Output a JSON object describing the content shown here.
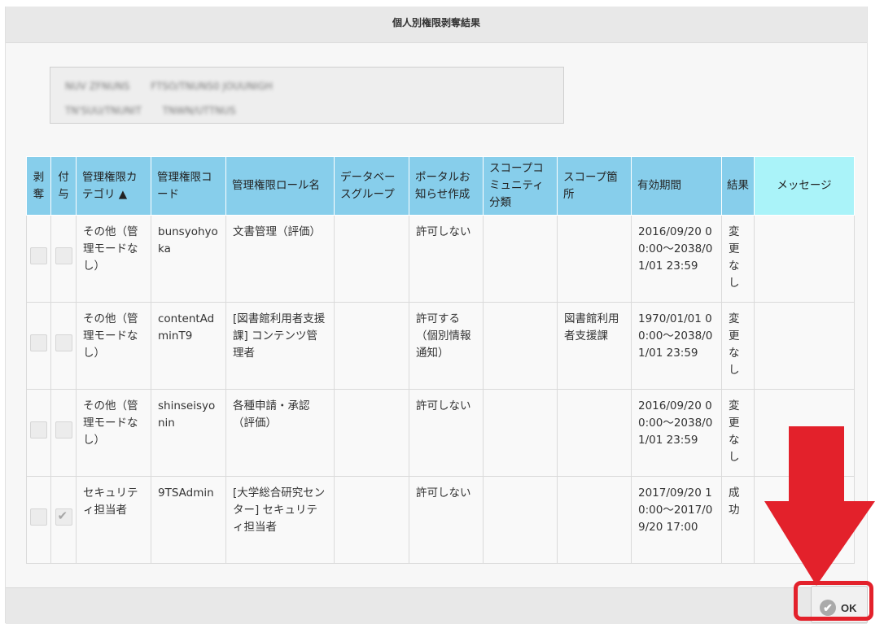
{
  "dialog": {
    "title": "個人別権限剥奪結果",
    "info_lines": [
      [
        "NUV ZFNUNS",
        "FTSO/TNUNS0 JOUUNIGH"
      ],
      [
        "TN'SUU/TNUNIT",
        "TNWN/UTTNUS"
      ]
    ]
  },
  "table": {
    "headers": {
      "revoke": "剥奪",
      "grant": "付与",
      "category": "管理権限カテゴリ ▲",
      "code": "管理権限コード",
      "role": "管理権限ロール名",
      "dbgroup": "データベースグループ",
      "portal": "ポータルお知らせ作成",
      "scope_comm": "スコープコミュニティ分類",
      "scope_place": "スコープ箇所",
      "period": "有効期間",
      "result": "結果",
      "message": "メッセージ"
    },
    "rows": [
      {
        "revoke_checked": false,
        "grant_checked": false,
        "category": "その他（管理モードなし）",
        "code": "bunsyohyoka",
        "role": "文書管理（評価）",
        "dbgroup": "",
        "portal": "許可しない",
        "scope_comm": "",
        "scope_place": "",
        "period": "2016/09/20 00:00～2038/01/01 23:59",
        "result": "変更なし",
        "message": ""
      },
      {
        "revoke_checked": false,
        "grant_checked": false,
        "category": "その他（管理モードなし）",
        "code": "contentAdminT9",
        "role": "[図書館利用者支援課] コンテンツ管理者",
        "dbgroup": "",
        "portal": "許可する（個別情報通知）",
        "scope_comm": "",
        "scope_place": "図書館利用者支援課",
        "period": "1970/01/01 00:00～2038/01/01 23:59",
        "result": "変更なし",
        "message": ""
      },
      {
        "revoke_checked": false,
        "grant_checked": false,
        "category": "その他（管理モードなし）",
        "code": "shinseisyonin",
        "role": "各種申請・承認（評価）",
        "dbgroup": "",
        "portal": "許可しない",
        "scope_comm": "",
        "scope_place": "",
        "period": "2016/09/20 00:00～2038/01/01 23:59",
        "result": "変更なし",
        "message": ""
      },
      {
        "revoke_checked": false,
        "grant_checked": true,
        "category": "セキュリティ担当者",
        "code": "9TSAdmin",
        "role": "[大学総合研究センター] セキュリティ担当者",
        "dbgroup": "",
        "portal": "許可しない",
        "scope_comm": "",
        "scope_place": "",
        "period": "2017/09/20 10:00～2017/09/20 17:00",
        "result": "成功",
        "message": ""
      }
    ]
  },
  "footer": {
    "ok_label": "OK",
    "ok_icon": "check-circle-icon"
  },
  "annotation": {
    "arrow_color": "#e3212b",
    "highlight_color": "#e3212b"
  }
}
